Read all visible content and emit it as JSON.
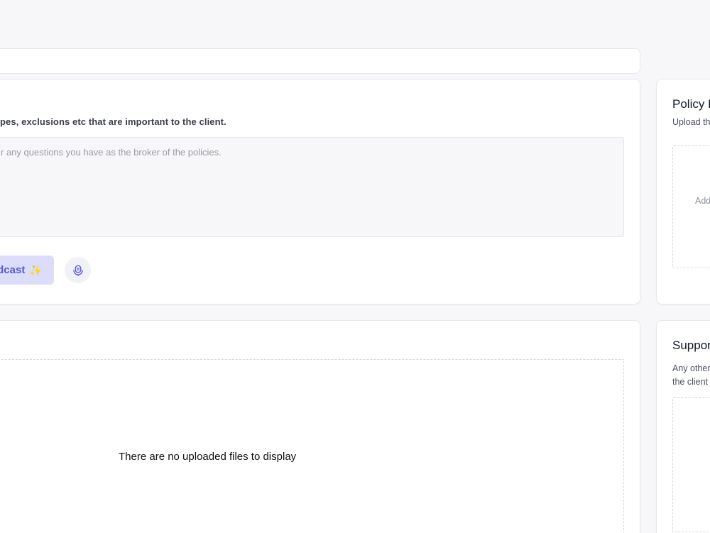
{
  "main": {
    "instruction_text": "pes, exclusions etc that are important to the client.",
    "notes_placeholder": "r any questions you have as the broker of the policies.",
    "podcast_button_label": "dcast",
    "podcast_sparkle": "✨",
    "mic_icon": "microphone-icon"
  },
  "files": {
    "empty_text": "There are no uploaded files to display"
  },
  "side": {
    "policy_title": "Policy D",
    "policy_subtitle": "Upload th",
    "policy_add_label": "Add",
    "supporting_title": "Suppor",
    "supporting_subtitle_line1": "Any other",
    "supporting_subtitle_line2": "the client"
  },
  "colors": {
    "background": "#f7f7f9",
    "accent": "#5a57d6",
    "accent_bg": "#dcdcfb",
    "sparkle": "#f2a93b"
  }
}
